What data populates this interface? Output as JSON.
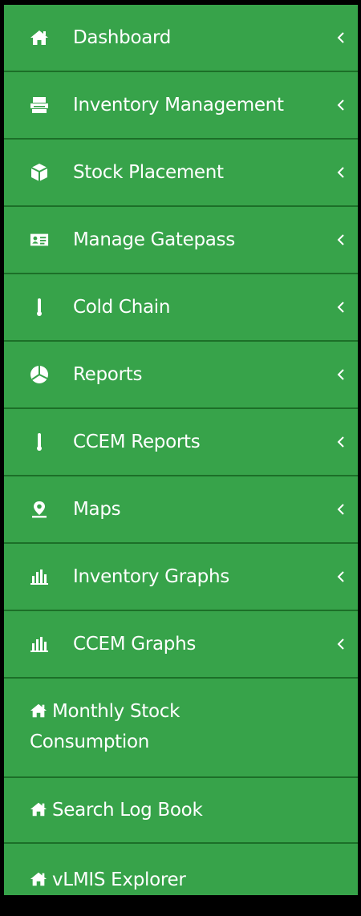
{
  "sidebar": {
    "items": [
      {
        "label": "Dashboard",
        "icon": "home-icon"
      },
      {
        "label": "Inventory Management",
        "icon": "printer-icon"
      },
      {
        "label": "Stock Placement",
        "icon": "cube-icon"
      },
      {
        "label": "Manage Gatepass",
        "icon": "id-card-icon"
      },
      {
        "label": "Cold Chain",
        "icon": "thermometer-icon"
      },
      {
        "label": "Reports",
        "icon": "pie-chart-icon"
      },
      {
        "label": "CCEM Reports",
        "icon": "thermometer-icon"
      },
      {
        "label": "Maps",
        "icon": "map-marker-icon"
      },
      {
        "label": "Inventory Graphs",
        "icon": "bar-chart-icon"
      },
      {
        "label": "CCEM Graphs",
        "icon": "bar-chart-icon"
      },
      {
        "label": "Monthly Stock Consumption",
        "icon": "home-icon"
      },
      {
        "label": "Search Log Book",
        "icon": "home-icon"
      },
      {
        "label": "vLMIS Explorer",
        "icon": "home-icon"
      }
    ],
    "expand_icon": "chevron-left-icon"
  },
  "colors": {
    "sidebar_bg": "#37a34a",
    "divider": "#1c6f28",
    "text": "#ffffff",
    "frame": "#000000"
  }
}
